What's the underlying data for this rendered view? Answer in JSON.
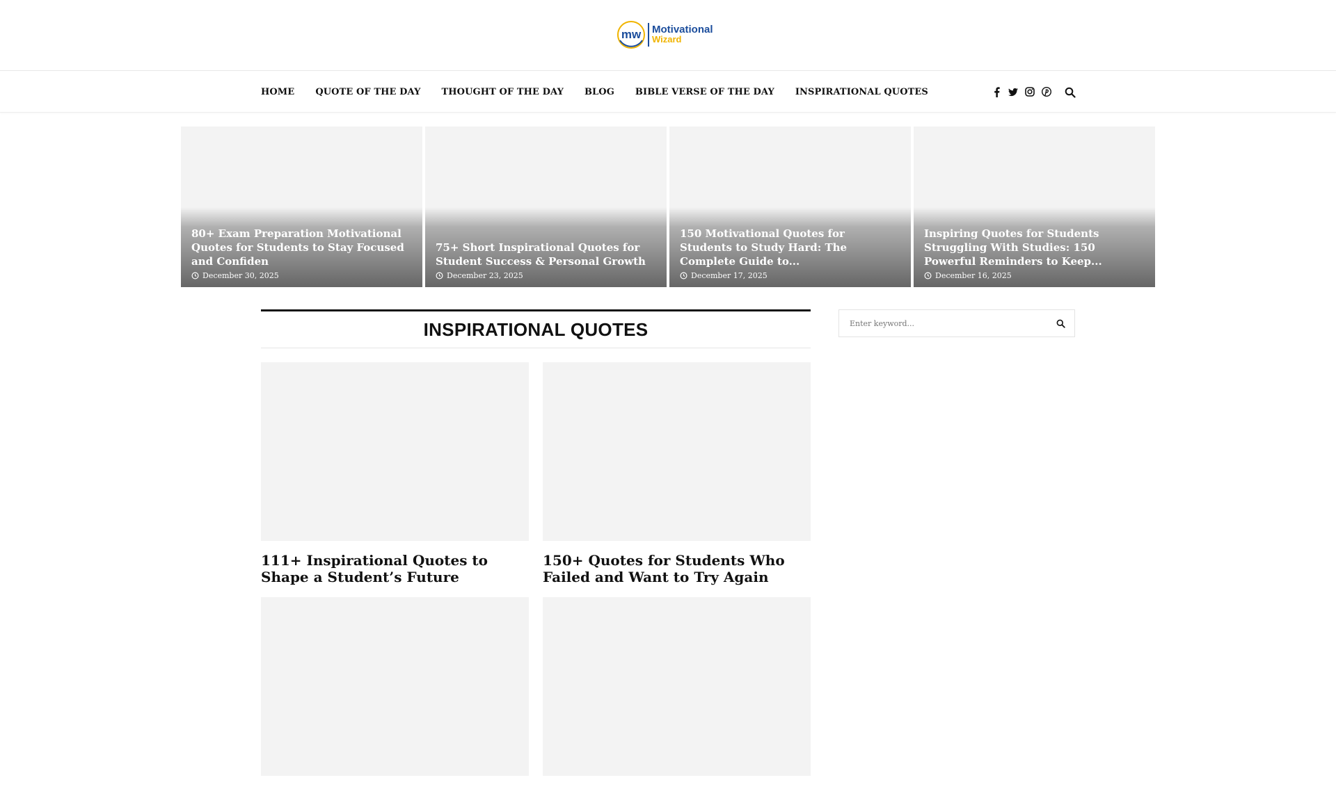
{
  "header": {
    "logo_line1": "Motivational",
    "logo_line2": "Wizard",
    "logo_mark_text": "mw"
  },
  "nav": {
    "items": [
      {
        "label": "HOME"
      },
      {
        "label": "QUOTE OF THE DAY"
      },
      {
        "label": "THOUGHT OF THE DAY"
      },
      {
        "label": "BLOG"
      },
      {
        "label": "BIBLE VERSE OF THE DAY"
      },
      {
        "label": "INSPIRATIONAL QUOTES"
      }
    ],
    "social_icons": [
      "facebook-icon",
      "twitter-icon",
      "instagram-icon",
      "pinterest-icon"
    ],
    "search_icon": "search-icon"
  },
  "slider": {
    "items": [
      {
        "title": "80+ Exam Preparation Motivational Quotes for Students to Stay Focused and Confiden",
        "date": "December 30, 2025"
      },
      {
        "title": "75+ Short Inspirational Quotes for Student Success & Personal Growth",
        "date": "December 23, 2025"
      },
      {
        "title": "150 Motivational Quotes for Students to Study Hard: The Complete Guide to...",
        "date": "December 17, 2025"
      },
      {
        "title": "Inspiring Quotes for Students Struggling With Studies: 150 Powerful Reminders to Keep...",
        "date": "December 16, 2025"
      }
    ]
  },
  "section": {
    "title": "INSPIRATIONAL QUOTES"
  },
  "posts": [
    {
      "title": "111+ Inspirational Quotes to Shape a Student’s Future"
    },
    {
      "title": "150+ Quotes for Students Who Failed and Want to Try Again"
    },
    {
      "title": ""
    },
    {
      "title": ""
    }
  ],
  "sidebar": {
    "search_placeholder": "Enter keyword..."
  },
  "colors": {
    "brand_blue": "#1b4d9c",
    "brand_yellow": "#f0b400",
    "placeholder_gray": "#f3f3f3"
  }
}
